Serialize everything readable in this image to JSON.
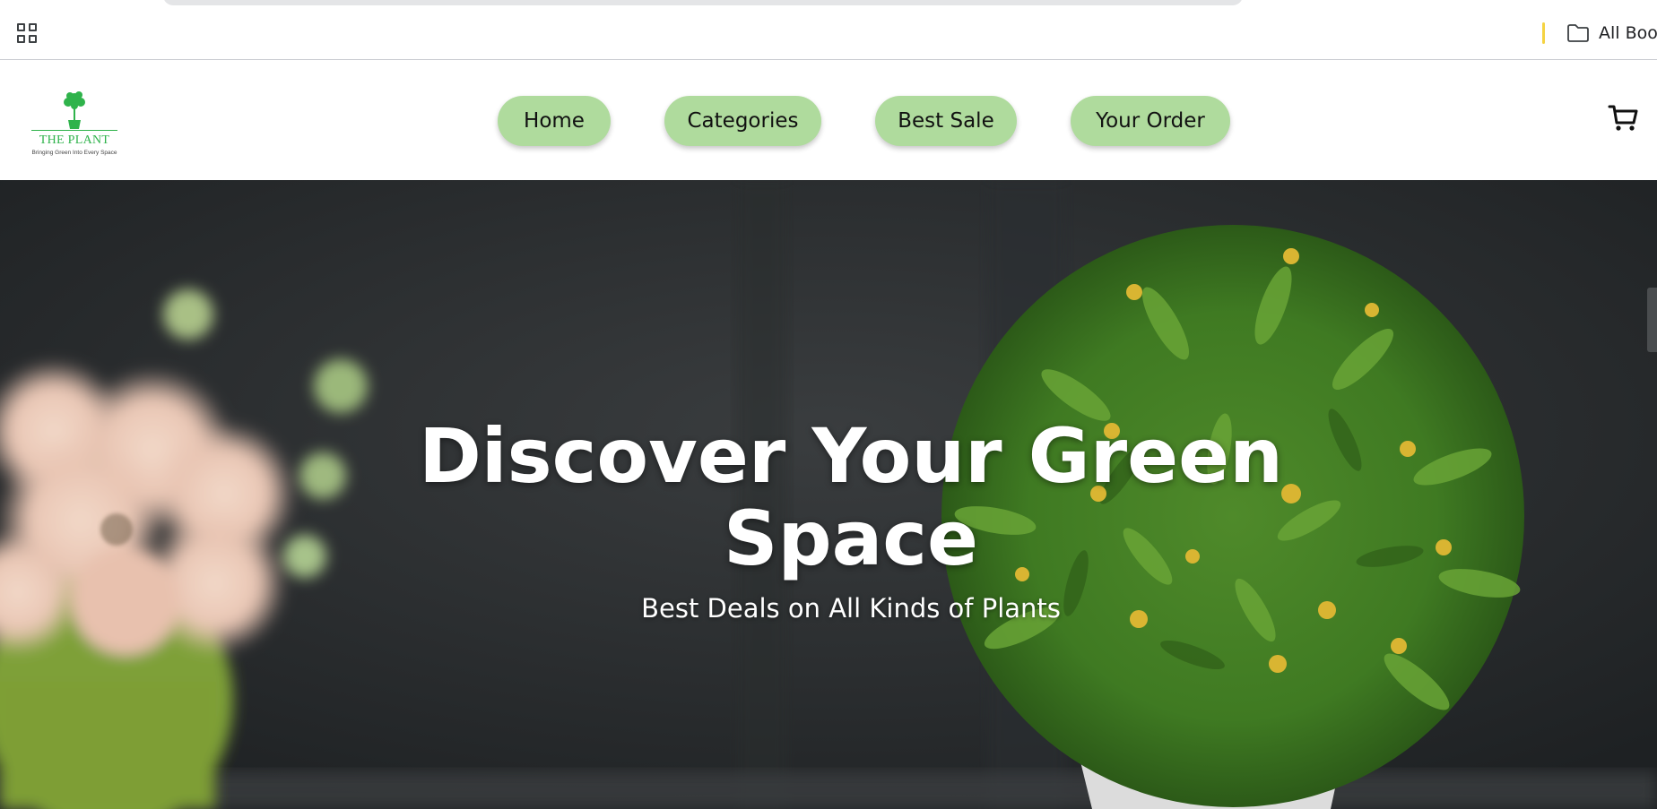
{
  "browser": {
    "apps_icon": "apps-grid-icon",
    "bookmark_folder": {
      "icon": "folder-icon",
      "label": "All Book"
    },
    "divider_color": "#f5d342"
  },
  "site": {
    "logo": {
      "title": "THE PLANT",
      "tagline": "Bringing Green Into Every Space",
      "color": "#2fb34b"
    },
    "nav": [
      {
        "label": "Home"
      },
      {
        "label": "Categories"
      },
      {
        "label": "Best Sale"
      },
      {
        "label": "Your Order"
      }
    ],
    "nav_color": "#afdb9d",
    "cart_icon": "cart-icon"
  },
  "hero": {
    "title": "Discover Your Green Space",
    "subtitle": "Best Deals on All Kinds of Plants"
  }
}
